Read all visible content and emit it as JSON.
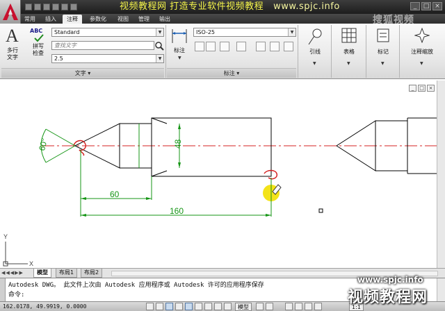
{
  "titlebar": {
    "watermark": "视频教程网 打造专业软件视频教程",
    "watermark_url": "www.spjc.info",
    "corner_watermark": "搜狐视频"
  },
  "ribbon": {
    "tabs": [
      {
        "label": "常用",
        "active": false
      },
      {
        "label": "插入",
        "active": false
      },
      {
        "label": "注释",
        "active": true
      },
      {
        "label": "参数化",
        "active": false
      },
      {
        "label": "视图",
        "active": false
      },
      {
        "label": "管理",
        "active": false
      },
      {
        "label": "输出",
        "active": false
      }
    ],
    "text_panel": {
      "title": "文字",
      "multiline_label_1": "多行",
      "multiline_label_2": "文字",
      "spell_icon_text": "ABC",
      "spell_label_1": "拼写",
      "spell_label_2": "检查",
      "style_value": "Standard",
      "find_placeholder": "查找文字",
      "height_value": "2.5"
    },
    "dim_panel": {
      "title": "标注",
      "dim_label": "标注",
      "style_value": "ISO-25"
    },
    "leader_label": "引线",
    "table_label": "表格",
    "mark_label": "标记",
    "scale_label": "注释缩放"
  },
  "drawing": {
    "dim_angle": "60°",
    "dim_diameter": "48",
    "dim_length_short": "60",
    "dim_length_long": "160",
    "axis_y": "Y",
    "axis_x": "X",
    "colors": {
      "outline": "#000000",
      "centerline": "#d42020",
      "dimension": "#159515",
      "highlight": "#f2e000"
    }
  },
  "layout_tabs": [
    {
      "label": "模型",
      "active": true
    },
    {
      "label": "布局1",
      "active": false
    },
    {
      "label": "布局2",
      "active": false
    }
  ],
  "command": {
    "line1": "Autodesk DWG。  此文件上次由 Autodesk 应用程序或 Autodesk 许可的应用程序保存",
    "line2": "命令:"
  },
  "status": {
    "coords": "162.0178, 49.9919, 0.0000",
    "model_label": "模型",
    "scale_label": "1:1"
  },
  "watermark_bottom": {
    "url": "www.spjc.info",
    "text": "视频教程网"
  }
}
